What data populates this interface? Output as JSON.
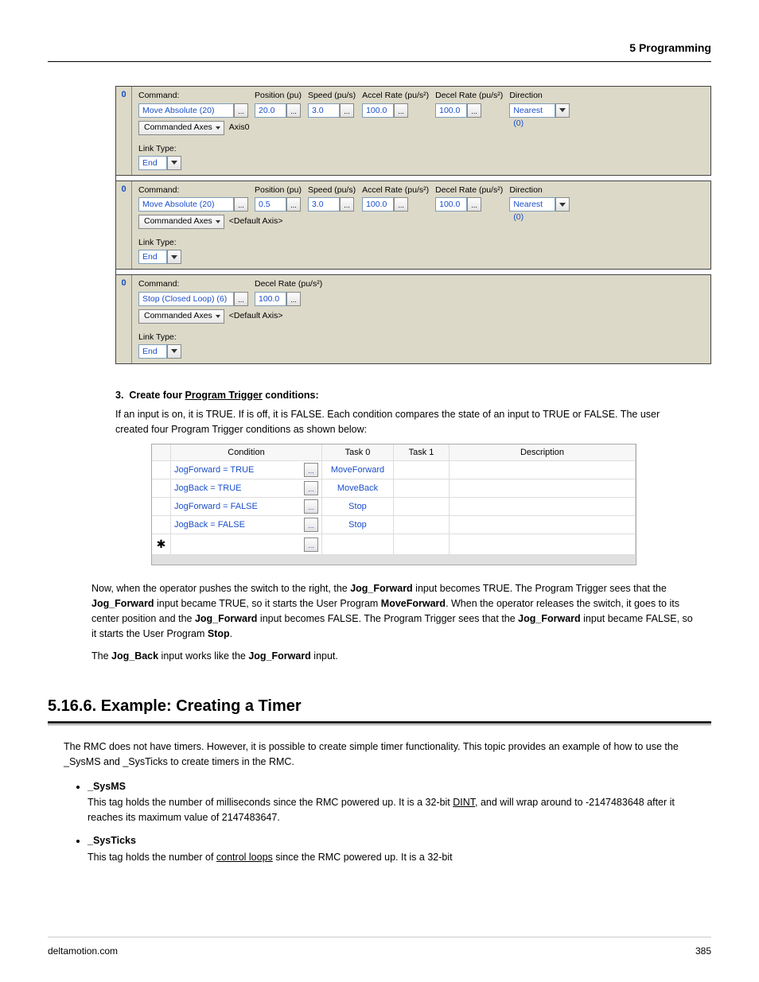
{
  "header": "5  Programming",
  "footer": {
    "left": "deltamotion.com",
    "right": "385"
  },
  "steps": [
    {
      "handle": "0",
      "labels": {
        "cmd": "Command:",
        "pos": "Position (pu)",
        "spd": "Speed (pu/s)",
        "acc": "Accel Rate (pu/s²)",
        "dec": "Decel Rate (pu/s²)",
        "dir": "Direction"
      },
      "cmd": "Move Absolute (20)",
      "pos": "20.0",
      "spd": "3.0",
      "acc": "100.0",
      "dec": "100.0",
      "dir": "Nearest (0)",
      "axes_label": "Commanded Axes",
      "axes_val": "Axis0",
      "link_label": "Link Type:",
      "link_val": "End"
    },
    {
      "handle": "0",
      "labels": {
        "cmd": "Command:",
        "pos": "Position (pu)",
        "spd": "Speed (pu/s)",
        "acc": "Accel Rate (pu/s²)",
        "dec": "Decel Rate (pu/s²)",
        "dir": "Direction"
      },
      "cmd": "Move Absolute (20)",
      "pos": "0.5",
      "spd": "3.0",
      "acc": "100.0",
      "dec": "100.0",
      "dir": "Nearest (0)",
      "axes_label": "Commanded Axes",
      "axes_val": "<Default Axis>",
      "link_label": "Link Type:",
      "link_val": "End"
    },
    {
      "handle": "0",
      "labels": {
        "cmd": "Command:",
        "dec": "Decel Rate (pu/s²)"
      },
      "cmd": "Stop (Closed Loop) (6)",
      "dec": "100.0",
      "axes_label": "Commanded Axes",
      "axes_val": "<Default Axis>",
      "link_label": "Link Type:",
      "link_val": "End"
    }
  ],
  "list3": {
    "num": "3.",
    "title_pre": "Create four ",
    "title_u": "Program Trigger",
    "title_post": " conditions:",
    "body": "If an input is on, it is TRUE. If is off, it is FALSE. Each condition compares the state of an input to TRUE or FALSE. The user created four Program Trigger conditions as shown below:"
  },
  "trig": {
    "headers": {
      "cond": "Condition",
      "t0": "Task 0",
      "t1": "Task 1",
      "desc": "Description"
    },
    "rows": [
      {
        "cond": "JogForward = TRUE",
        "t0": "MoveForward",
        "t1": "",
        "desc": ""
      },
      {
        "cond": "JogBack = TRUE",
        "t0": "MoveBack",
        "t1": "",
        "desc": ""
      },
      {
        "cond": "JogForward = FALSE",
        "t0": "Stop",
        "t1": "",
        "desc": ""
      },
      {
        "cond": "JogBack = FALSE",
        "t0": "Stop",
        "t1": "",
        "desc": ""
      }
    ],
    "star": "✱"
  },
  "para": {
    "p1a": "Now, when the operator pushes the switch to the right, the ",
    "p1b": "Jog_Forward",
    "p1c": " input becomes TRUE. The Program Trigger sees that the ",
    "p1d": "Jog_Forward",
    "p1e": " input became TRUE, so it starts the User Program ",
    "p1f": "MoveForward",
    "p1g": ". When the operator releases the switch, it goes to its center position and the ",
    "p1h": "Jog_Forward",
    "p1i": " input becomes FALSE. The Program Trigger sees that the ",
    "p1j": "Jog_Forward",
    "p1k": " input became FALSE, so it starts the User Program ",
    "p1l": "Stop",
    "p1m": ".",
    "p2a": "The ",
    "p2b": "Jog_Back",
    "p2c": " input works like the ",
    "p2d": "Jog_Forward",
    "p2e": " input."
  },
  "section": "5.16.6. Example: Creating a Timer",
  "sectext": "The RMC does not have timers. However, it is possible to create simple timer functionality. This topic provides an example of how to use the _SysMS and _SysTicks to create timers in the RMC.",
  "bullets": [
    {
      "t": "_SysMS",
      "d1": "This tag holds the number of milliseconds since the RMC powered up. It is a 32-bit ",
      "du": "DINT",
      "d2": ", and will wrap around to -2147483648 after it reaches its maximum value of 2147483647."
    },
    {
      "t": "_SysTicks",
      "d1": "This tag holds the number of ",
      "du": "control loops",
      "d2": " since the RMC powered up. It is a 32-bit"
    }
  ],
  "ell": "..."
}
